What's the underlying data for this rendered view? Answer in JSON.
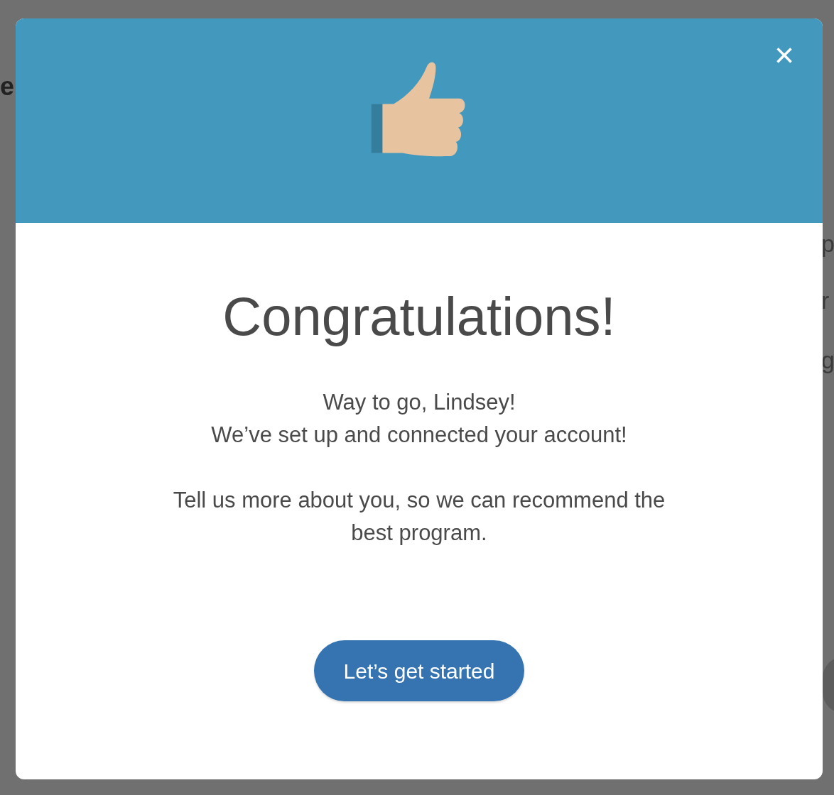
{
  "background": {
    "heading_fragment": "e",
    "side_fragments": [
      "p",
      "r",
      "g"
    ]
  },
  "dialog": {
    "close": "×",
    "title": "Congratulations!",
    "message_lines": [
      "Way to go, Lindsey!",
      "We’ve set up and connected your account!"
    ],
    "prompt": "Tell us more about you, so we can recommend the best program.",
    "button": "Let’s get started"
  }
}
